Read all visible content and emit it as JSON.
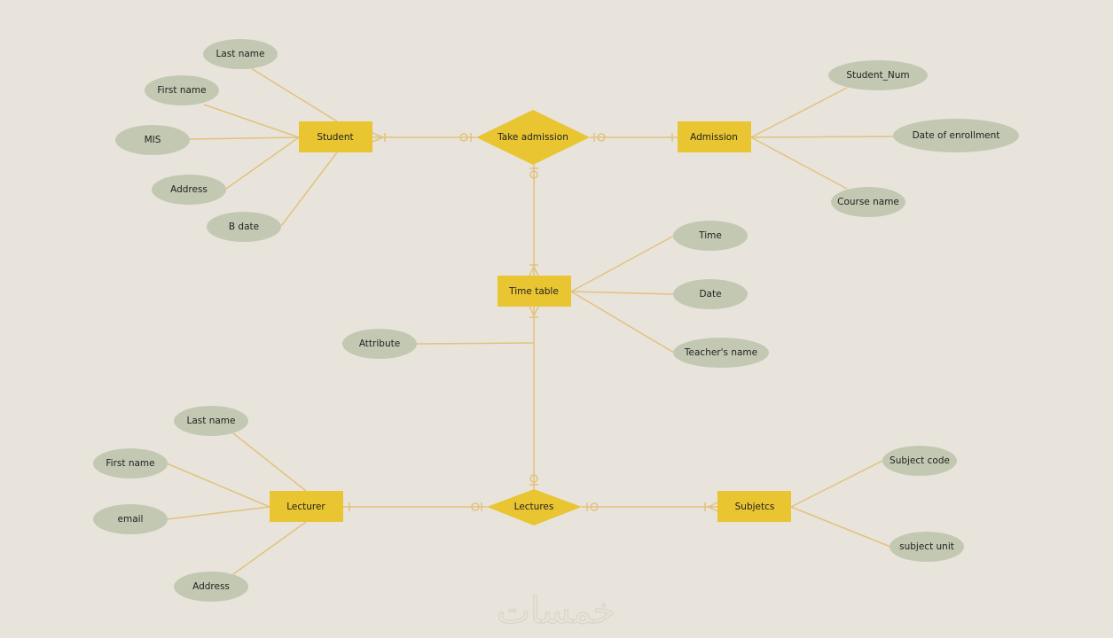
{
  "colors": {
    "background": "#e8e4dc",
    "entity": "#e8c531",
    "attribute": "#c3c8b2",
    "connector": "#e2c27c"
  },
  "entities": {
    "student": "Student",
    "admission": "Admission",
    "time_table": "Time table",
    "lecturer": "Lecturer",
    "subjects": "Subjetcs"
  },
  "relationships": {
    "take_admission": "Take admission",
    "lectures": "Lectures"
  },
  "attributes": {
    "student": [
      "Last name",
      "First name",
      "MIS",
      "Address",
      "B date"
    ],
    "admission": [
      "Student_Num",
      "Date of enrollment",
      "Course name"
    ],
    "time_table": [
      "Time",
      "Date",
      "Teacher's name",
      "Attribute"
    ],
    "lecturer": [
      "Last name",
      "First name",
      "email",
      "Address"
    ],
    "subjects": [
      "Subject code",
      "subject unit"
    ]
  },
  "watermark": "خمسات"
}
